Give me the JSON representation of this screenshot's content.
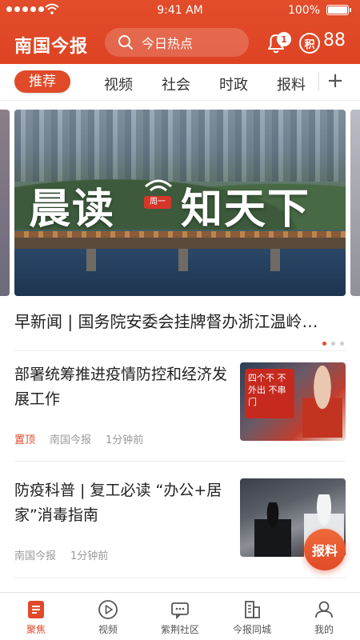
{
  "status_bar": {
    "time": "9:41 AM",
    "battery": "100%"
  },
  "header": {
    "logo": "南国今报",
    "search_placeholder": "今日热点",
    "notification_count": "1",
    "points_icon_label": "积",
    "points_value": "88"
  },
  "tabs": [
    "推荐",
    "视频",
    "社会",
    "时政",
    "报料"
  ],
  "tab_add": "+",
  "banner": {
    "title_left": "晨读",
    "badge": "周一",
    "title_right": "知天下",
    "headline": "早新闻 | 国务院安委会挂牌督办浙江温岭…"
  },
  "articles": [
    {
      "title": "部署统筹推进疫情防控和经济发展工作",
      "pin": "置顶",
      "source": "南国今报",
      "time": "1分钟前",
      "image_text": "四个不 不外出 不串门"
    },
    {
      "title": "防疫科普 | 复工必读 “办公+居家”消毒指南",
      "source": "南国今报",
      "time": "1分钟前"
    }
  ],
  "fab_label": "报料",
  "bottom_nav": [
    {
      "label": "聚焦",
      "icon": "focus-icon"
    },
    {
      "label": "视频",
      "icon": "play-icon"
    },
    {
      "label": "紫荆社区",
      "icon": "community-icon"
    },
    {
      "label": "今报同城",
      "icon": "city-icon"
    },
    {
      "label": "我的",
      "icon": "profile-icon"
    }
  ],
  "colors": {
    "brand": "#e04a28",
    "header": "#de4324"
  }
}
